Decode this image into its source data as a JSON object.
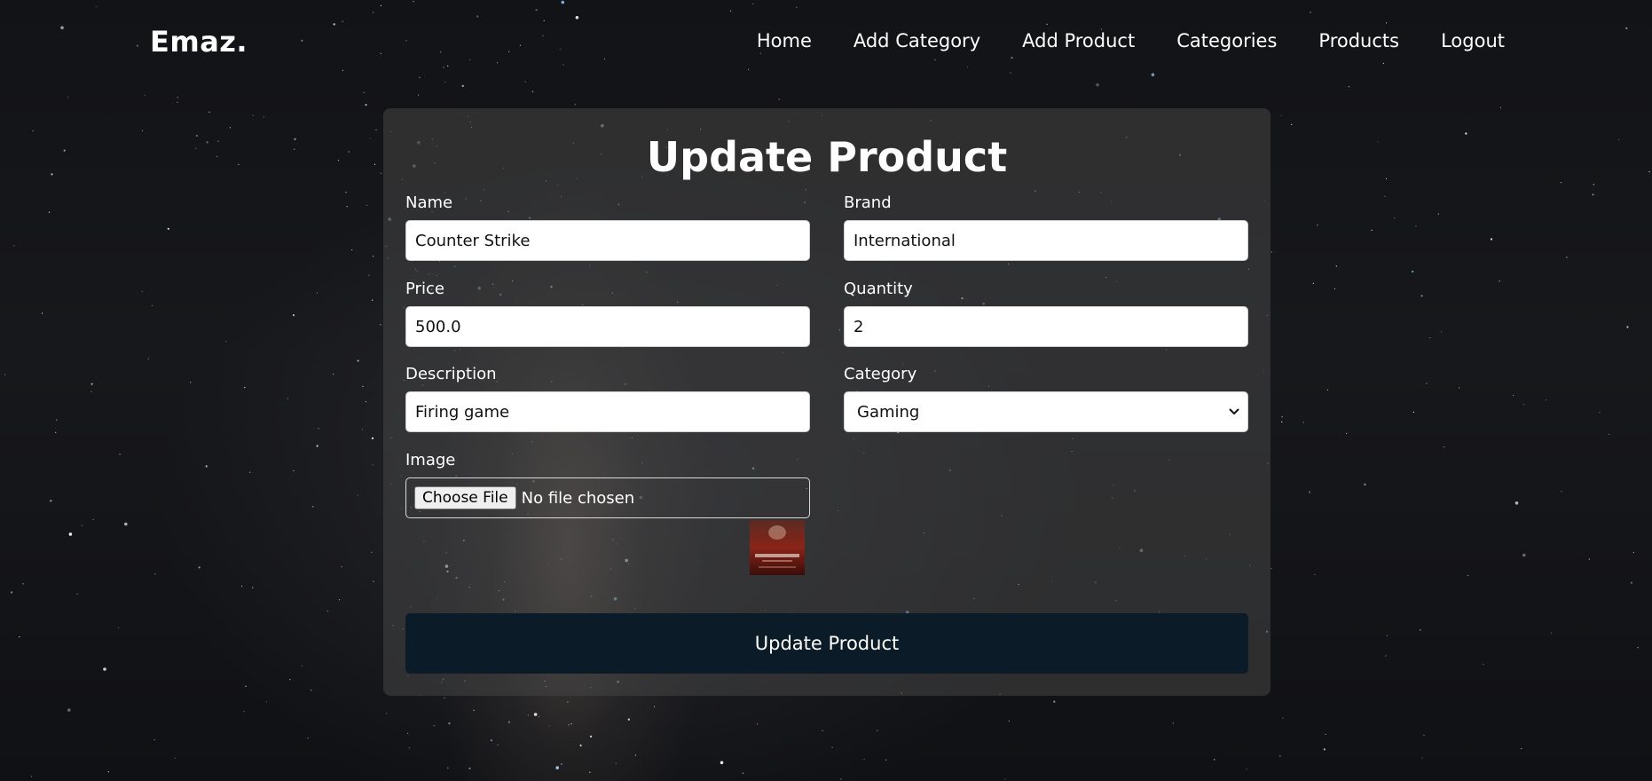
{
  "nav": {
    "brand": "Emaz.",
    "links": [
      "Home",
      "Add Category",
      "Add Product",
      "Categories",
      "Products",
      "Logout"
    ]
  },
  "form": {
    "title": "Update Product",
    "name": {
      "label": "Name",
      "value": "Counter Strike"
    },
    "brand": {
      "label": "Brand",
      "value": "International"
    },
    "price": {
      "label": "Price",
      "value": "500.0"
    },
    "quantity": {
      "label": "Quantity",
      "value": "2"
    },
    "description": {
      "label": "Description",
      "value": "Firing game"
    },
    "category": {
      "label": "Category",
      "selected": "Gaming"
    },
    "image": {
      "label": "Image",
      "button": "Choose File",
      "status": "No file chosen",
      "thumbnail_text": "Counter Strike"
    },
    "submit": "Update Product"
  },
  "colors": {
    "background": "#141518",
    "card": "#464646",
    "submit_button": "#0b1c28",
    "text": "#ffffff"
  }
}
